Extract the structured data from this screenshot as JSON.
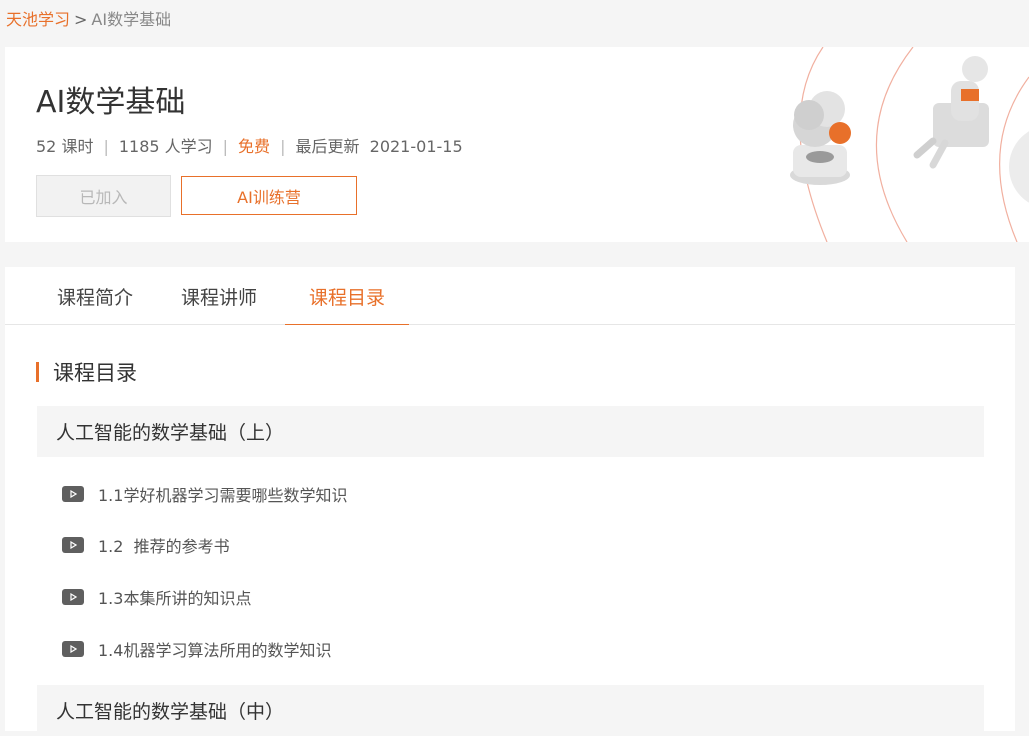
{
  "breadcrumb": {
    "home": "天池学习",
    "separator": ">",
    "current": "AI数学基础"
  },
  "course": {
    "title": "AI数学基础",
    "lessons_count": "52 课时",
    "learners": "1185 人学习",
    "price": "免费",
    "updated_label": "最后更新",
    "updated_date": "2021-01-15",
    "joined_button": "已加入",
    "camp_button": "AI训练营"
  },
  "tabs": [
    {
      "label": "课程简介",
      "active": false
    },
    {
      "label": "课程讲师",
      "active": false
    },
    {
      "label": "课程目录",
      "active": true
    }
  ],
  "catalog": {
    "heading": "课程目录",
    "chapters": [
      {
        "title": "人工智能的数学基础（上）",
        "lessons": [
          "1.1学好机器学习需要哪些数学知识",
          "1.2  推荐的参考书",
          "1.3本集所讲的知识点",
          "1.4机器学习算法所用的数学知识"
        ]
      },
      {
        "title": "人工智能的数学基础（中）",
        "lessons": []
      }
    ]
  },
  "colors": {
    "accent": "#e8702a",
    "page_bg": "#f5f5f5",
    "card_bg": "#ffffff",
    "chapter_bg": "#f5f5f5"
  }
}
